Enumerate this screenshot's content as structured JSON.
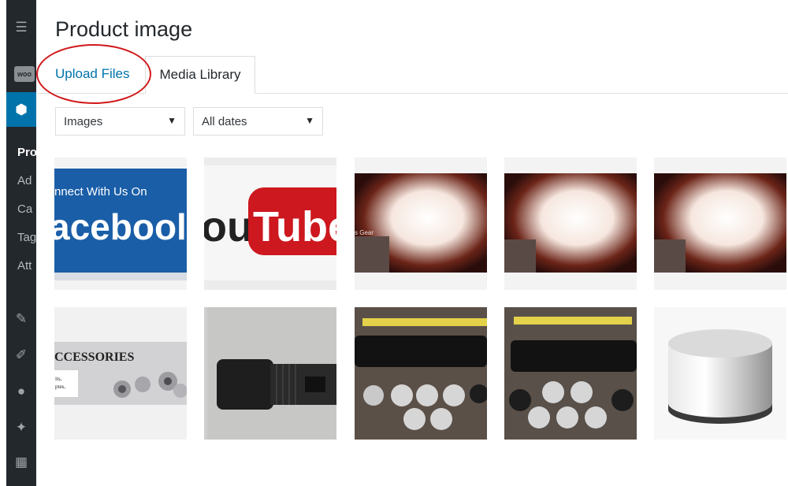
{
  "modal": {
    "title": "Product image",
    "tabs": [
      {
        "label": "Upload Files"
      },
      {
        "label": "Media Library"
      }
    ]
  },
  "filters": {
    "type_selected": "Images",
    "date_selected": "All dates"
  },
  "sidebar": {
    "items": [
      {
        "label": "Pro"
      },
      {
        "label": "Ad"
      },
      {
        "label": "Ca"
      },
      {
        "label": "Tag"
      },
      {
        "label": "Att"
      }
    ]
  },
  "thumbnails": {
    "facebook": {
      "line1": "nnect With Us On",
      "line2": "acebool"
    },
    "youtube": {
      "prefix": "ou",
      "tube": "Tube"
    },
    "fire": {
      "caption": "s Gear"
    },
    "accessories": {
      "title": "CCESSORIES",
      "line1": "its,",
      "line2": "ptes,"
    }
  },
  "colors": {
    "accent": "#0073aa",
    "sidebar": "#23282d",
    "highlight_circle": "#d0181a",
    "youtube_red": "#cc181e",
    "facebook_blue": "#1a5ea8"
  }
}
